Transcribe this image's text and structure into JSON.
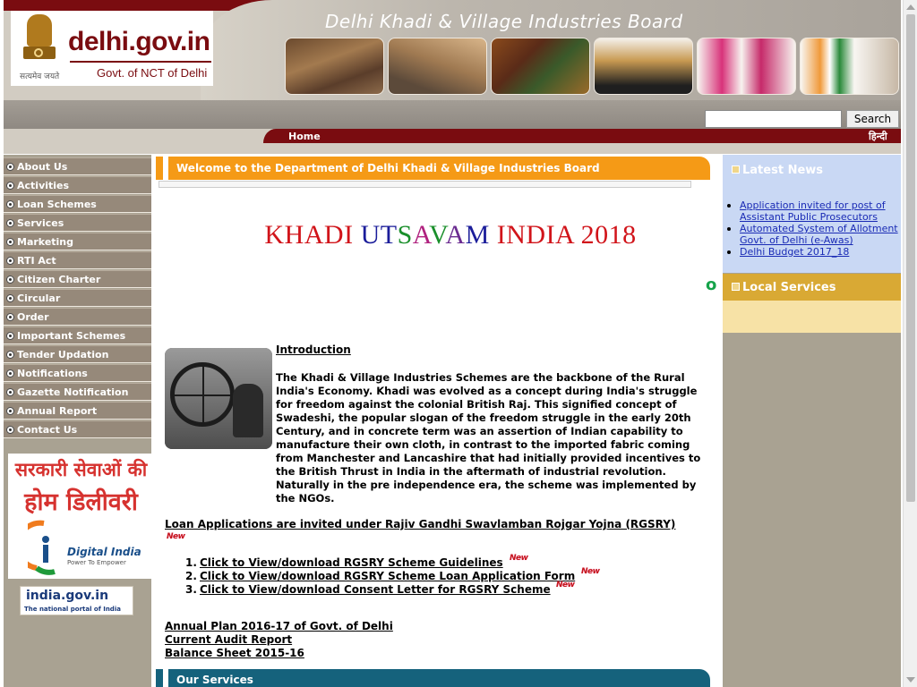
{
  "header": {
    "site_name": "delhi.gov.in",
    "site_sub": "Govt. of NCT of Delhi",
    "motto": "सत्यमेव जयते",
    "board_title": "Delhi Khadi & Village Industries Board",
    "search_button": "Search",
    "search_placeholder": "",
    "home": "Home",
    "hindi": "हिन्दी"
  },
  "nav": {
    "items": [
      {
        "label": "About Us"
      },
      {
        "label": "Activities"
      },
      {
        "label": "Loan Schemes"
      },
      {
        "label": "Services"
      },
      {
        "label": "Marketing"
      },
      {
        "label": "RTI Act"
      },
      {
        "label": "Citizen Charter"
      },
      {
        "label": "Circular"
      },
      {
        "label": "Order"
      },
      {
        "label": "Important Schemes"
      },
      {
        "label": "Tender Updation"
      },
      {
        "label": "Notifications"
      },
      {
        "label": "Gazette Notification"
      },
      {
        "label": "Annual Report"
      },
      {
        "label": "Contact Us"
      }
    ]
  },
  "banners": {
    "hd_line1": "सरकारी सेवाओं की",
    "hd_line2": "होम डिलीवरी",
    "digital_india": "Digital India",
    "digital_india_sub": "Power To Empower",
    "india_gov": "india.gov.in",
    "india_gov_sub": "The national portal of India"
  },
  "main": {
    "welcome": "Welcome to the Department of Delhi Khadi & Village Industries Board",
    "khadi_title": {
      "part1": "KHADI ",
      "part2": "U",
      "part3": "T",
      "part4": "S",
      "part5": "A",
      "part6": "V",
      "part7": "A",
      "part8": "M",
      "part9": " INDIA 2018"
    },
    "marquee_char": "o",
    "intro_heading": "Introduction",
    "intro_body": "The Khadi & Village Industries Schemes are the backbone of the Rural India's Economy. Khadi was evolved as a concept during India's struggle for freedom against the colonial British Raj. This signified concept of Swadeshi, the popular slogan of the freedom struggle in the early 20th Century, and in concrete term was an assertion of Indian capability to manufacture their own cloth, in contrast to the imported fabric coming from Manchester and Lancashire that had initially provided incentives to the British Thrust in India in the aftermath of industrial revolution. Naturally in the pre independence era, the scheme was implemented by the NGOs.",
    "rgsry_link": "Loan Applications are invited under Rajiv Gandhi Swavlamban Rojgar Yojna (RGSRY)",
    "new_badge": "New",
    "rgsry_items": [
      {
        "num": "1.",
        "label": "Click to View/download RGSRY Scheme Guidelines"
      },
      {
        "num": "2.",
        "label": "Click to View/download RGSRY Scheme Loan Application Form"
      },
      {
        "num": "3.",
        "label": "Click to View/download Consent Letter for RGSRY Scheme"
      }
    ],
    "doc_links": [
      "Annual Plan 2016-17 of Govt. of Delhi",
      "Current  Audit  Report",
      "Balance Sheet 2015-16"
    ],
    "services_heading": "Our Services"
  },
  "right": {
    "news_heading": "Latest News",
    "news": [
      "Application invited for post of Assistant Public Prosecutors",
      "Automated System of Allotment Govt. of Delhi (e-Awas)",
      "Delhi Budget 2017_18"
    ],
    "local_heading": "Local Services"
  },
  "colors": {
    "maroon": "#7a0c10",
    "nav_bg": "#96897a",
    "welcome_orange": "#f59a16",
    "services_teal": "#15627c",
    "news_blue": "#c9d8f4",
    "local_gold": "#d9a934"
  }
}
